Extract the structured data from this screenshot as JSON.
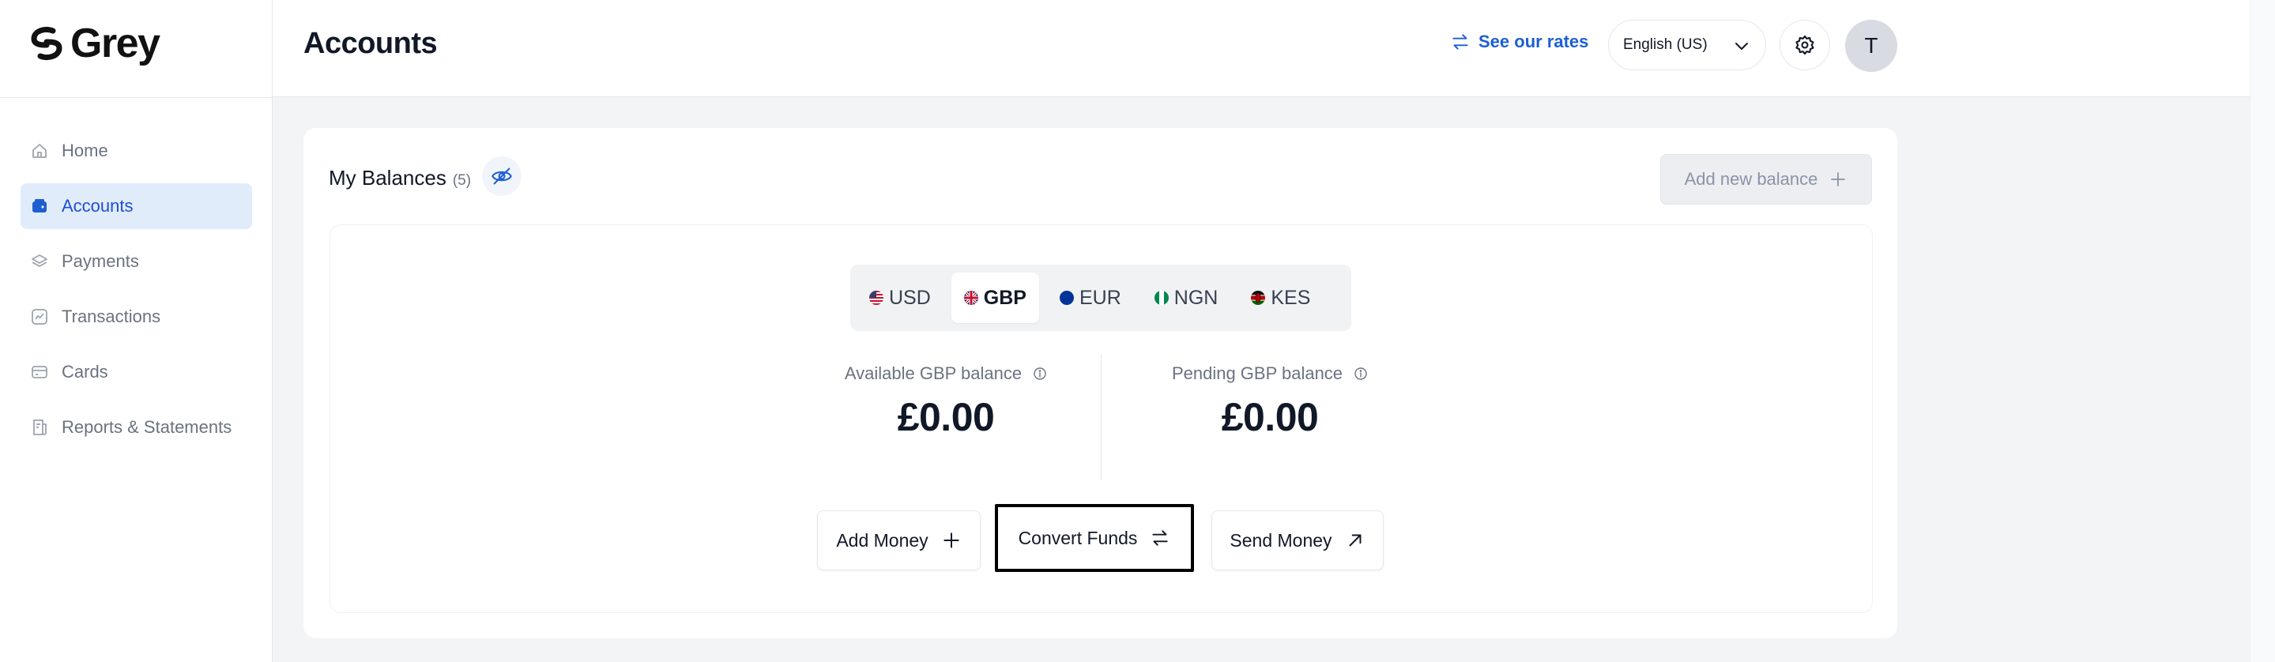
{
  "brand": {
    "name": "Grey"
  },
  "sidebar": {
    "items": [
      {
        "label": "Home",
        "icon": "home-icon"
      },
      {
        "label": "Accounts",
        "icon": "wallet-icon",
        "active": true
      },
      {
        "label": "Payments",
        "icon": "layers-icon"
      },
      {
        "label": "Transactions",
        "icon": "chart-icon"
      },
      {
        "label": "Cards",
        "icon": "card-icon"
      },
      {
        "label": "Reports & Statements",
        "icon": "report-icon"
      }
    ]
  },
  "header": {
    "title": "Accounts",
    "rates_link": "See our rates",
    "language": "English (US)",
    "avatar_initial": "T"
  },
  "balances": {
    "title": "My Balances",
    "count": "(5)",
    "add_new_label": "Add new balance",
    "tabs": [
      {
        "label": "USD",
        "flag": "us-flag"
      },
      {
        "label": "GBP",
        "flag": "uk-flag",
        "active": true
      },
      {
        "label": "EUR",
        "flag": "eu-flag"
      },
      {
        "label": "NGN",
        "flag": "ng-flag"
      },
      {
        "label": "KES",
        "flag": "ke-flag"
      }
    ],
    "available_label": "Available GBP balance",
    "available_amount": "£0.00",
    "pending_label": "Pending GBP balance",
    "pending_amount": "£0.00",
    "actions": {
      "add_money": "Add Money",
      "convert_funds": "Convert Funds",
      "send_money": "Send Money"
    }
  },
  "colors": {
    "accent": "#1d5fd1",
    "active_nav_bg": "#e1ecfb",
    "page_bg": "#f3f4f6"
  }
}
